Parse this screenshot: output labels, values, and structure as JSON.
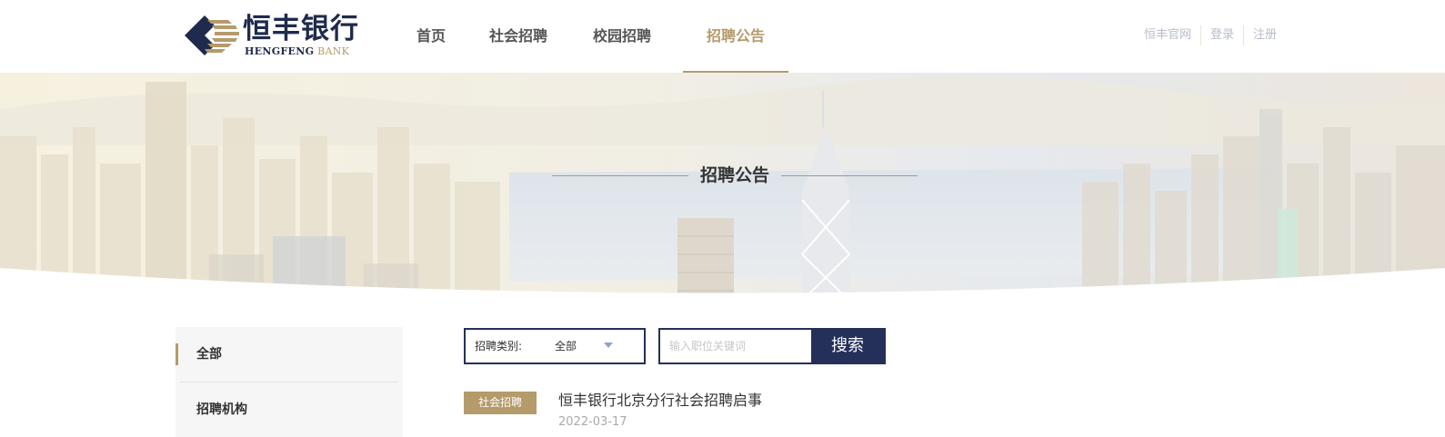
{
  "brand": {
    "name_cn": "恒丰银行",
    "name_en_1": "HENGFENG",
    "name_en_2": "BANK",
    "primary_color": "#1f2a4d",
    "accent_color": "#b59a6a"
  },
  "nav": {
    "items": [
      {
        "label": "首页",
        "active": false
      },
      {
        "label": "社会招聘",
        "active": false
      },
      {
        "label": "校园招聘",
        "active": false
      },
      {
        "label": "招聘公告",
        "active": true
      }
    ]
  },
  "top_links": [
    {
      "label": "恒丰官网"
    },
    {
      "label": "登录"
    },
    {
      "label": "注册"
    }
  ],
  "banner": {
    "title": "招聘公告"
  },
  "sidebar": {
    "items": [
      {
        "label": "全部",
        "active": true
      },
      {
        "label": "招聘机构",
        "active": false
      }
    ]
  },
  "filter": {
    "label": "招聘类别:",
    "value": "全部",
    "caret_icon": "caret-down-icon"
  },
  "search": {
    "placeholder": "输入职位关键词",
    "value": "",
    "button_label": "搜索"
  },
  "listings": [
    {
      "tag": "社会招聘",
      "title": "恒丰银行北京分行社会招聘启事",
      "date": "2022-03-17"
    }
  ]
}
